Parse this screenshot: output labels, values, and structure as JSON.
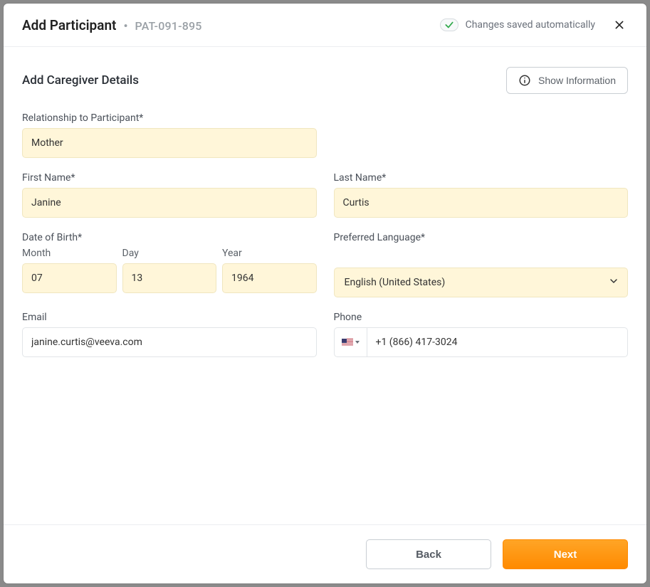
{
  "header": {
    "title": "Add Participant",
    "patient_id": "PAT-091-895",
    "saved_label": "Changes saved automatically"
  },
  "section": {
    "title": "Add Caregiver Details",
    "show_info_label": "Show Information"
  },
  "form": {
    "relationship": {
      "label": "Relationship to Participant*",
      "value": "Mother"
    },
    "first_name": {
      "label": "First Name*",
      "value": "Janine"
    },
    "last_name": {
      "label": "Last Name*",
      "value": "Curtis"
    },
    "dob": {
      "label": "Date of Birth*",
      "month": {
        "label": "Month",
        "value": "07"
      },
      "day": {
        "label": "Day",
        "value": "13"
      },
      "year": {
        "label": "Year",
        "value": "1964"
      }
    },
    "language": {
      "label": "Preferred Language*",
      "value": "English (United States)"
    },
    "email": {
      "label": "Email",
      "value": "janine.curtis@veeva.com"
    },
    "phone": {
      "label": "Phone",
      "value": "+1 (866) 417-3024",
      "country": "us"
    }
  },
  "footer": {
    "back": "Back",
    "next": "Next"
  }
}
